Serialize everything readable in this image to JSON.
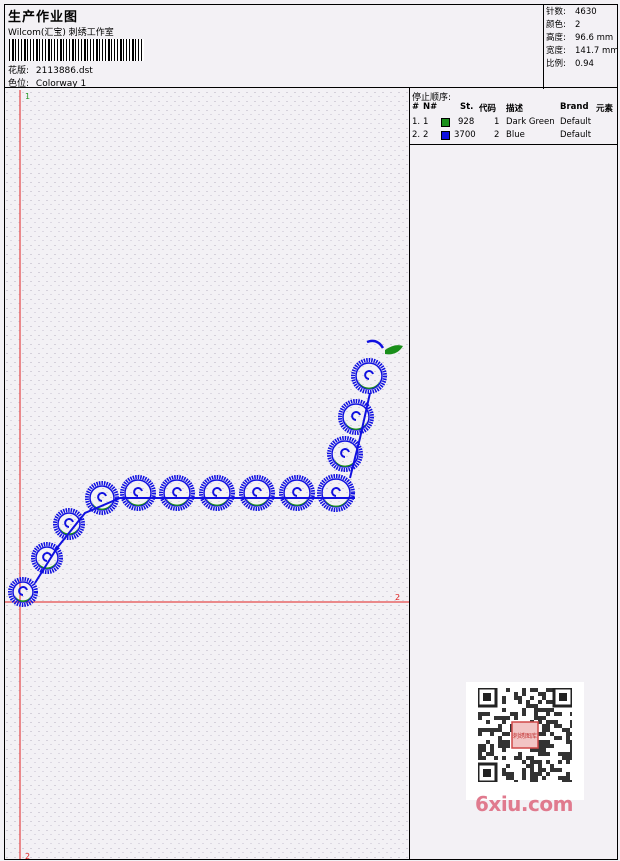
{
  "header": {
    "title": "生产作业图",
    "subtitle": "Wilcom(汇宝) 刺绣工作室",
    "design_label": "花版:",
    "design_value": "2113886.dst",
    "colorway_label": "色位:",
    "colorway_value": "Colorway 1"
  },
  "stats": [
    {
      "label": "针数:",
      "value": "4630"
    },
    {
      "label": "颜色:",
      "value": "2"
    },
    {
      "label": "高度:",
      "value": "96.6 mm"
    },
    {
      "label": "宽度:",
      "value": "141.7 mm"
    },
    {
      "label": "比例:",
      "value": "0.94"
    }
  ],
  "canvas": {
    "axis_top_label": "1",
    "axis_right_label": "2",
    "axis_bottom_label": "2"
  },
  "stop_sequence": {
    "title": "停止顺序:",
    "columns": [
      "#",
      "N#",
      "St.",
      "代码",
      "描述",
      "Brand",
      "元素"
    ],
    "rows": [
      {
        "seq": "1.",
        "n": "1",
        "color": "#1a8f1a",
        "stitches": "928",
        "code": "1",
        "desc": "Dark Green",
        "brand": "Default"
      },
      {
        "seq": "2.",
        "n": "2",
        "color": "#1010e0",
        "stitches": "3700",
        "code": "2",
        "desc": "Blue",
        "brand": "Default"
      }
    ]
  },
  "watermark": {
    "text": "6xiu.com",
    "seal_text": "刺绣图库"
  },
  "colors": {
    "thread_blue": "#1010e0",
    "thread_green": "#1a8f1a",
    "axis_red": "#e02020",
    "axis_green": "#2a9a2a"
  }
}
